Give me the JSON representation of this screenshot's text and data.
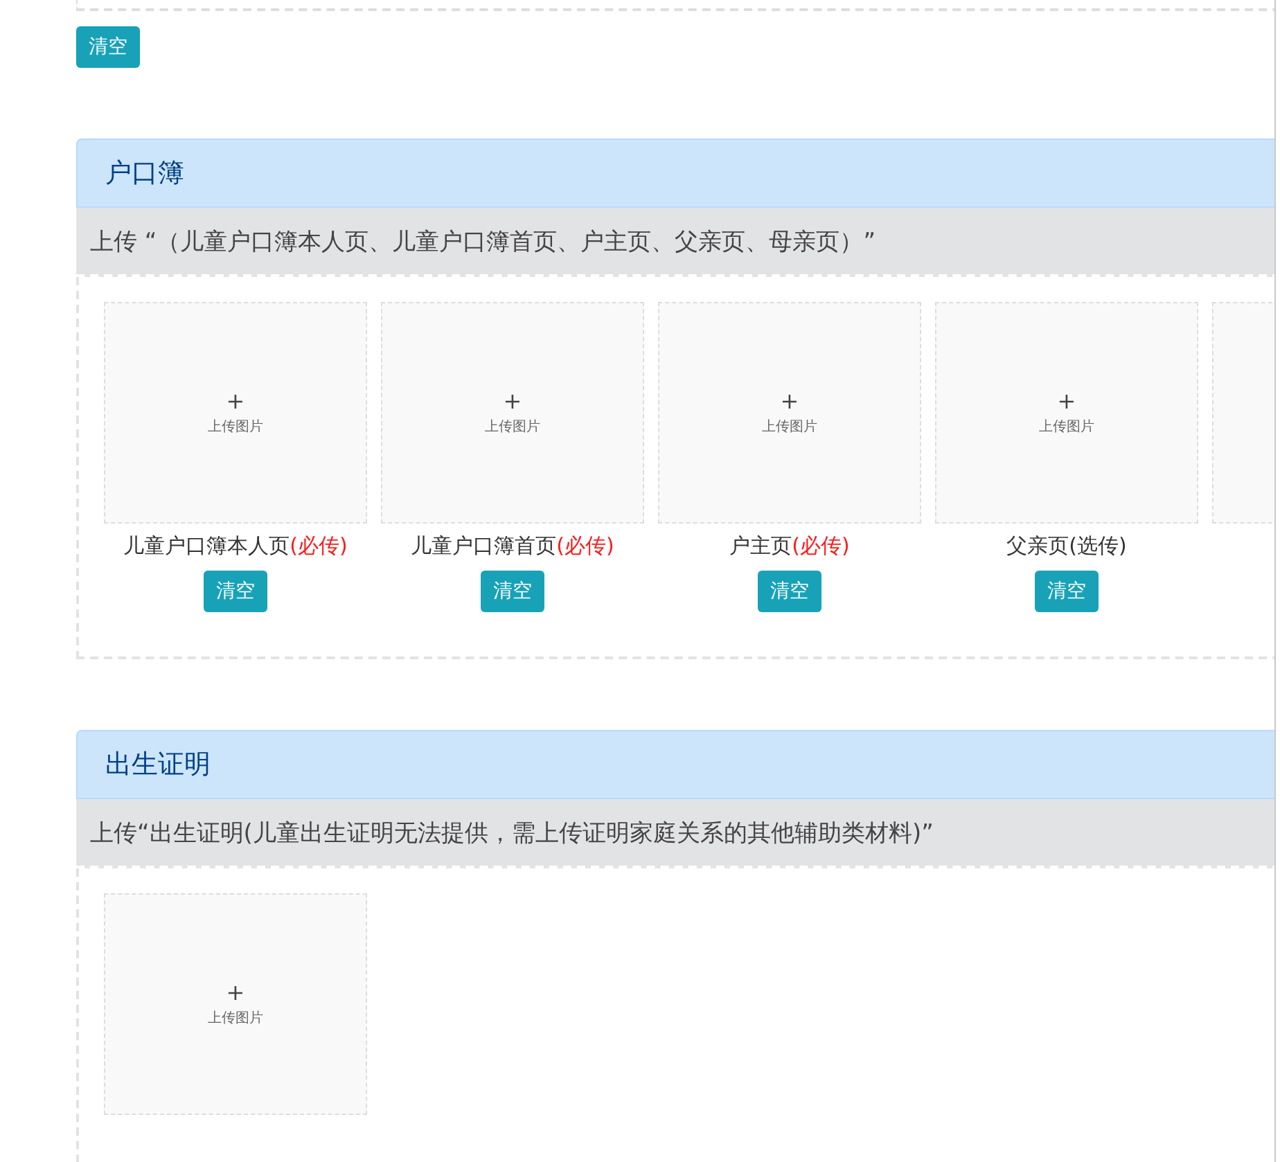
{
  "top_clear_button": "清空",
  "sections": [
    {
      "title": "户口簿",
      "instruction": "上传 “（儿童户口簿本人页、儿童户口簿首页、户主页、父亲页、母亲页）”",
      "tiles": [
        {
          "kind": "full",
          "plus": "+",
          "hint": "上传图片",
          "label": "儿童户口簿本人页",
          "tag": "(必传)",
          "required": true,
          "button": "清空"
        },
        {
          "kind": "full",
          "plus": "+",
          "hint": "上传图片",
          "label": "儿童户口簿首页",
          "tag": "(必传)",
          "required": true,
          "button": "清空"
        },
        {
          "kind": "full",
          "plus": "+",
          "hint": "上传图片",
          "label": "户主页",
          "tag": "(必传)",
          "required": true,
          "button": "清空"
        },
        {
          "kind": "full",
          "plus": "+",
          "hint": "上传图片",
          "label": "父亲页",
          "tag": "(选传)",
          "required": false,
          "button": "清空"
        },
        {
          "kind": "cut"
        }
      ]
    },
    {
      "title": "出生证明",
      "instruction": "上传“出生证明(儿童出生证明无法提供，需上传证明家庭关系的其他辅助类材料)”",
      "tiles": [
        {
          "kind": "upload",
          "plus": "+",
          "hint": "上传图片"
        }
      ]
    }
  ]
}
